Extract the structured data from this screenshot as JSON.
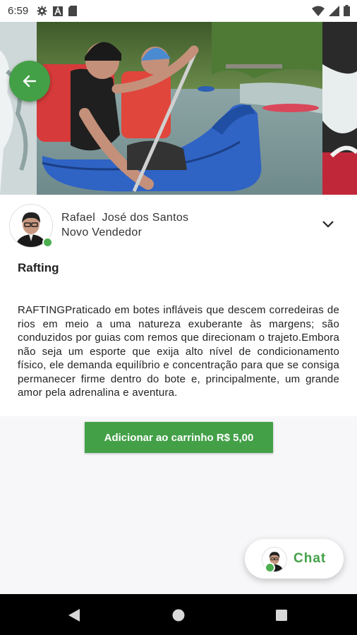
{
  "status_bar": {
    "time": "6:59",
    "icons": [
      "gear-icon",
      "a-icon",
      "sd-card-icon",
      "wifi-icon",
      "signal-icon",
      "battery-icon"
    ]
  },
  "hero": {
    "back_icon": "arrow-left-icon",
    "accent": "#43a047"
  },
  "seller": {
    "name": "Rafael  José dos Santos",
    "role": "Novo Vendedor",
    "online_color": "#4caf50"
  },
  "product": {
    "title": "Rafting",
    "description": "RAFTINGPraticado em botes infláveis que descem corredeiras de rios em meio a uma natureza exuberante às margens; são conduzidos por guias com remos que direcionam o trajeto.Embora não seja um esporte que exija alto nível de condicionamento físico, ele demanda equilíbrio e concentração para que se consiga permanecer firme dentro do bote e, principalmente, um grande amor pela adrenalina e aventura."
  },
  "cart_button": {
    "label": "Adicionar ao carrinho R$ 5,00"
  },
  "chat": {
    "label": "Chat"
  }
}
